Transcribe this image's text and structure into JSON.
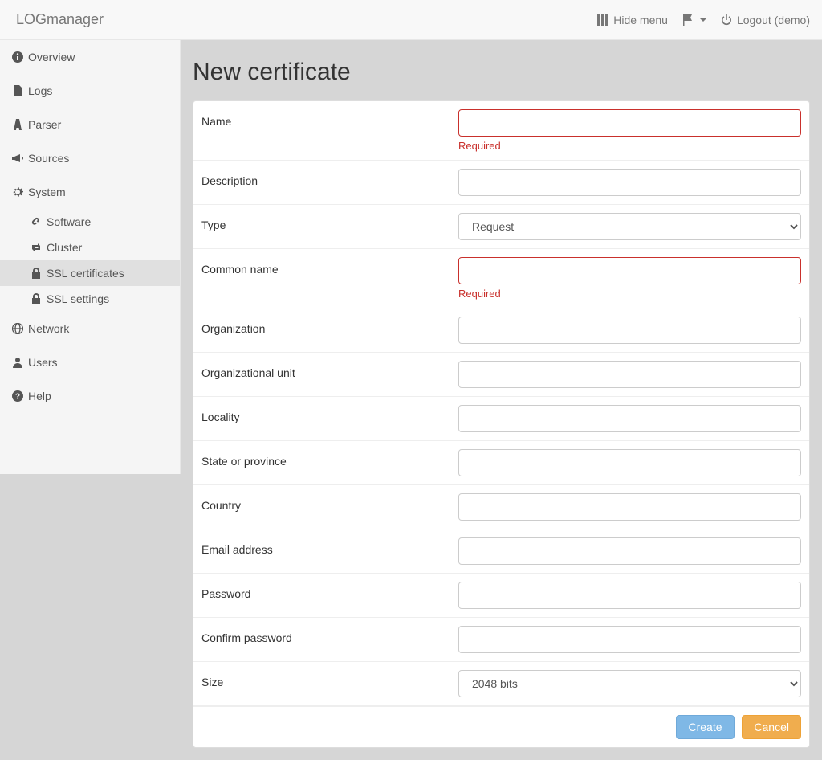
{
  "brand": "LOGmanager",
  "topbar": {
    "hide_menu": "Hide menu",
    "logout": "Logout (demo)"
  },
  "sidebar": {
    "overview": "Overview",
    "logs": "Logs",
    "parser": "Parser",
    "sources": "Sources",
    "system": "System",
    "software": "Software",
    "cluster": "Cluster",
    "ssl_certificates": "SSL certificates",
    "ssl_settings": "SSL settings",
    "network": "Network",
    "users": "Users",
    "help": "Help"
  },
  "page": {
    "title": "New certificate"
  },
  "form": {
    "name": {
      "label": "Name",
      "error": "Required"
    },
    "description": {
      "label": "Description"
    },
    "type": {
      "label": "Type",
      "value": "Request"
    },
    "common_name": {
      "label": "Common name",
      "error": "Required"
    },
    "organization": {
      "label": "Organization"
    },
    "org_unit": {
      "label": "Organizational unit"
    },
    "locality": {
      "label": "Locality"
    },
    "state": {
      "label": "State or province"
    },
    "country": {
      "label": "Country"
    },
    "email": {
      "label": "Email address"
    },
    "password": {
      "label": "Password"
    },
    "confirm_password": {
      "label": "Confirm password"
    },
    "size": {
      "label": "Size",
      "value": "2048 bits"
    }
  },
  "buttons": {
    "create": "Create",
    "cancel": "Cancel"
  }
}
